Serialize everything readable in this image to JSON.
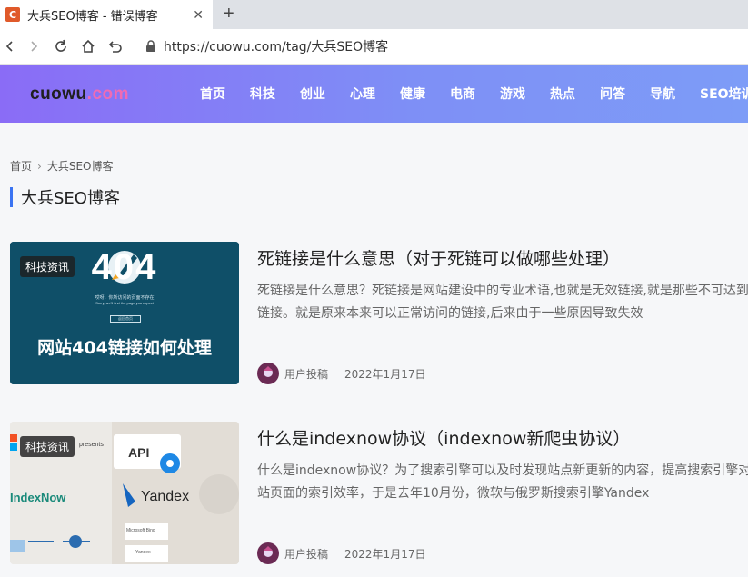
{
  "browser": {
    "tab_title": "大兵SEO博客 - 错误博客",
    "favicon_letter": "C",
    "url": "https://cuowu.com/tag/大兵SEO博客"
  },
  "site": {
    "logo_main": "cuowu",
    "logo_accent": ".com",
    "nav": [
      "首页",
      "科技",
      "创业",
      "心理",
      "健康",
      "电商",
      "游戏",
      "热点",
      "问答",
      "导航",
      "SEO培训"
    ]
  },
  "breadcrumb": {
    "home": "首页",
    "current": "大兵SEO博客"
  },
  "section_title": "大兵SEO博客",
  "articles": [
    {
      "badge": "科技资讯",
      "title": "死链接是什么意思（对于死链可以做哪些处理）",
      "excerpt": "死链接是什么意思？死链接是网站建设中的专业术语,也就是无效链接,就是那些不可达到的链接。就是原来本来可以正常访问的链接,后来由于一些原因导致失效",
      "author": "用户投稿",
      "date": "2022年1月17日",
      "thumb": {
        "big": "404",
        "caption": "网站404链接如何处理",
        "small_lines": [
          "哎呀，你所访问的页面不存在",
          "Sorry, we'll find the page you expect",
          "返回首页"
        ]
      }
    },
    {
      "badge": "科技资讯",
      "title": "什么是indexnow协议（indexnow新爬虫协议）",
      "excerpt": "什么是indexnow协议？为了搜索引擎可以及时发现站点新更新的内容，提高搜索引擎对网站页面的索引效率，于是去年10月份，微软与俄罗斯搜索引擎Yandex",
      "author": "用户投稿",
      "date": "2022年1月17日",
      "thumb": {
        "presents": "presents",
        "api": "API",
        "yandex": "Yandex",
        "indexnow": "IndexNow",
        "ms": "Microsoft Bing",
        "yd": "Yandex"
      }
    }
  ],
  "colors": {
    "accent": "#3b74f2",
    "header_start": "#8a6cf6",
    "header_end": "#7d9cf7",
    "logo_accent": "#f06bb3"
  }
}
